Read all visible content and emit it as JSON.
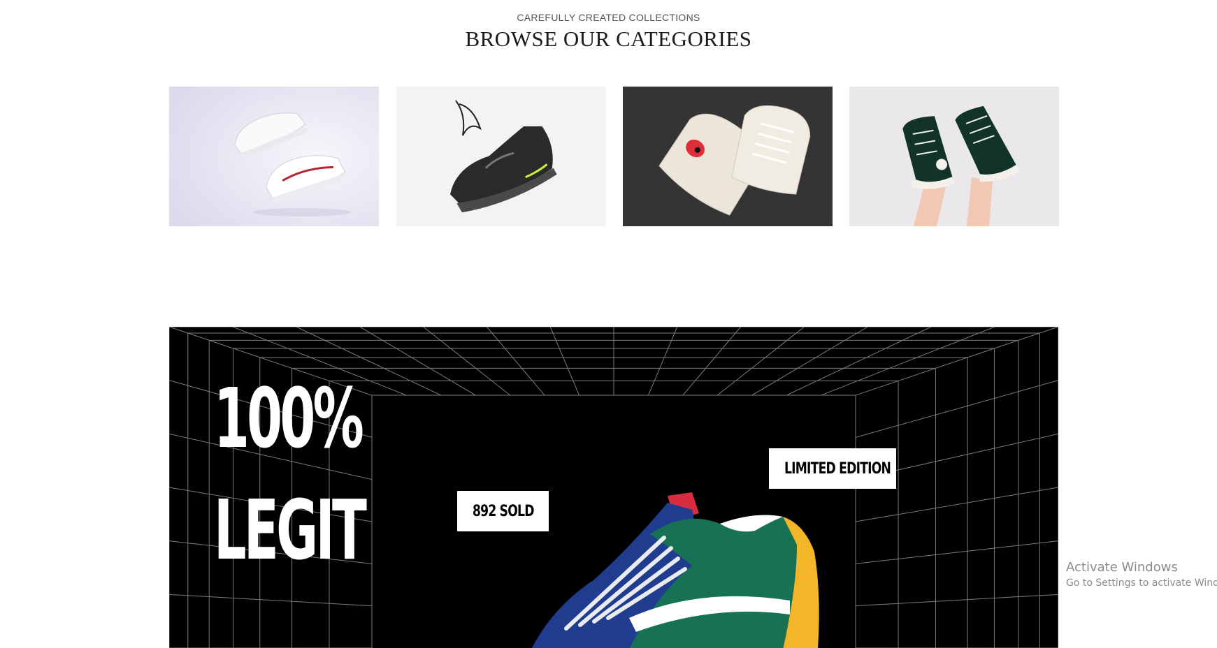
{
  "categories_section": {
    "eyebrow": "CAREFULLY CREATED COLLECTIONS",
    "title": "BROWSE OUR CATEGORIES",
    "tiles": [
      {
        "name": "white-sneakers",
        "bg": "#e6e4f1"
      },
      {
        "name": "black-running-shoe",
        "bg": "#f2f2f2"
      },
      {
        "name": "cream-converse-hearts",
        "bg": "#343436"
      },
      {
        "name": "green-high-top-converse",
        "bg": "#e9e7ea"
      }
    ]
  },
  "promo": {
    "line1": "100%",
    "line2": "LEGIT",
    "badge_sold": {
      "icon": "money-mouth-face-icon",
      "label": "892 SOLD"
    },
    "badge_limited": {
      "icon": "sunglasses-face-icon",
      "label": "LIMITED EDITION"
    },
    "colors": {
      "background": "#000000",
      "grid": "#8a8a8a",
      "text": "#ffffff"
    }
  },
  "os_watermark": {
    "line1": "Activate Windows",
    "line2": "Go to Settings to activate Windo"
  }
}
